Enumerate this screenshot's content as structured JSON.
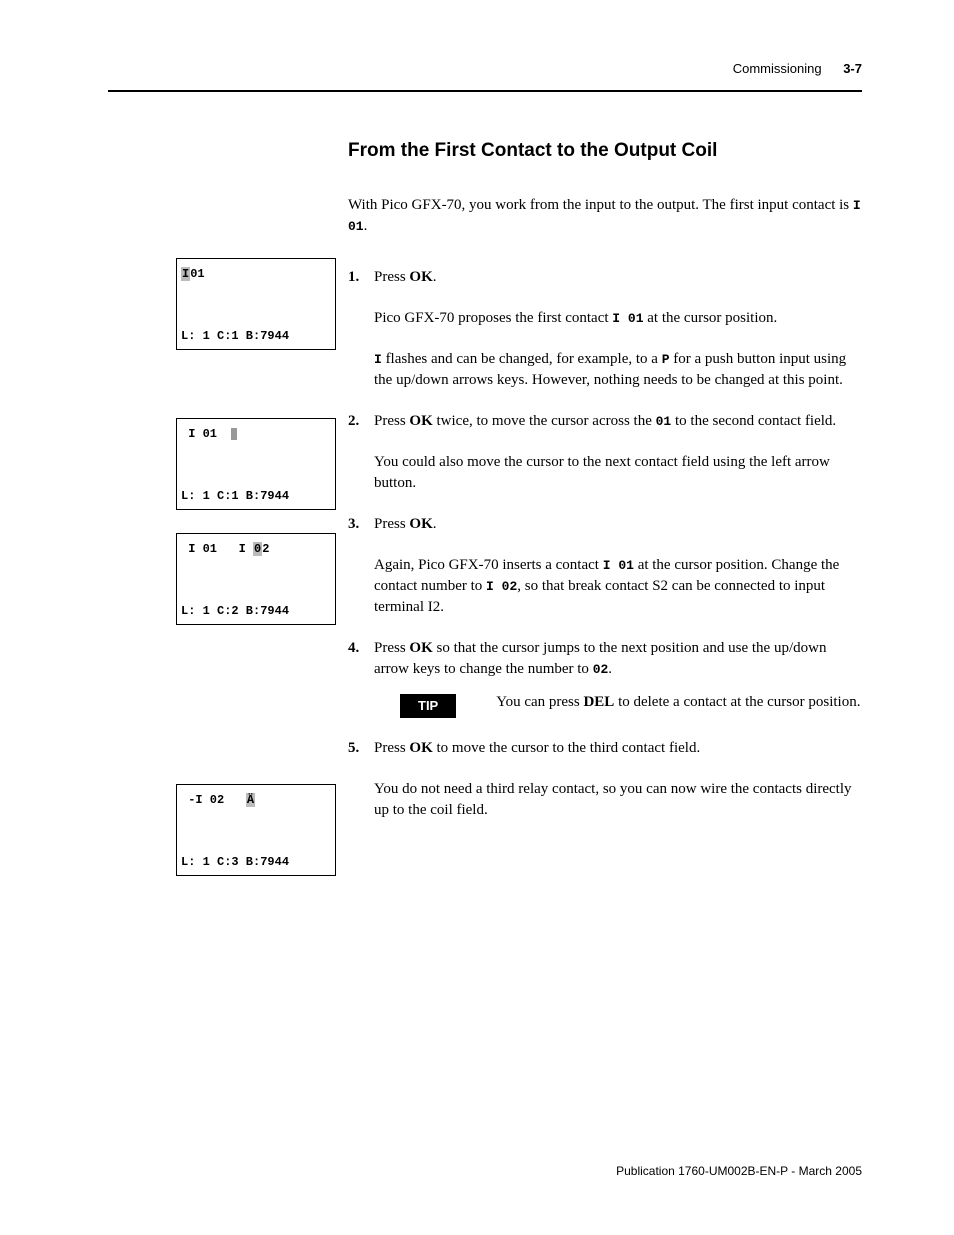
{
  "header": {
    "chapter": "Commissioning",
    "pagenum": "3-7"
  },
  "section_heading": "From the First Contact to the Output Coil",
  "intro": {
    "pre": "With Pico GFX-70, you work from the input to the output. The first input contact is ",
    "code": "I 01",
    "post": "."
  },
  "steps": {
    "s1": {
      "lead_pre": "Press ",
      "lead_bold": "OK",
      "lead_post": ".",
      "p1_pre": "Pico GFX-70 proposes the first contact ",
      "p1_code": "I 01",
      "p1_post": " at the cursor position.",
      "p2_code1": "I",
      "p2_a": " flashes and can be changed, for example, to a ",
      "p2_code2": "P",
      "p2_b": " for a push button input using the up/down arrows keys. However, nothing needs to be changed at this point."
    },
    "s2": {
      "lead_pre": "Press ",
      "lead_bold": "OK",
      "lead_mid": " twice, to move the cursor across the ",
      "lead_code": "01",
      "lead_post": " to the second contact field.",
      "p1": "You could also move the cursor to the next contact field using the left arrow button."
    },
    "s3": {
      "lead_pre": "Press ",
      "lead_bold": "OK",
      "lead_post": ".",
      "p1_pre": "Again, Pico GFX-70 inserts a contact ",
      "p1_code": "I 01",
      "p1_mid": " at the cursor position. Change the contact number to ",
      "p1_code2": "I 02",
      "p1_post": ", so that break contact S2 can be connected to input terminal I2."
    },
    "s4": {
      "lead_pre": "Press ",
      "lead_bold": "OK",
      "lead_mid": " so that the cursor jumps to the next position and use the up/down arrow keys to change the number to ",
      "lead_code": "02",
      "lead_post": "."
    },
    "tip": {
      "label": "TIP",
      "pre": "You can press ",
      "bold": "DEL",
      "post": " to delete a contact at the cursor position."
    },
    "s5": {
      "lead_pre": "Press ",
      "lead_bold": "OK",
      "lead_post": " to move the cursor to the third contact field.",
      "p1": "You do not need a third relay contact, so you can now wire the contacts directly up to the coil field."
    }
  },
  "lcd1": {
    "top_pre": "",
    "top_hl": "I",
    "top_post": " 01",
    "bottom": "L: 1 C:1 B:7944"
  },
  "lcd2": {
    "top": " I 01  ",
    "bottom": "L: 1 C:1 B:7944"
  },
  "lcd3": {
    "top_pre": " I 01   I ",
    "top_hl": "0",
    "top_post": "2",
    "bottom": "L: 1 C:2 B:7944"
  },
  "lcd4": {
    "top_pre": " -I 02   ",
    "top_hl": "Ä",
    "top_post": "",
    "bottom": "L: 1 C:3 B:7944"
  },
  "footer": "Publication 1760-UM002B-EN-P - March 2005"
}
